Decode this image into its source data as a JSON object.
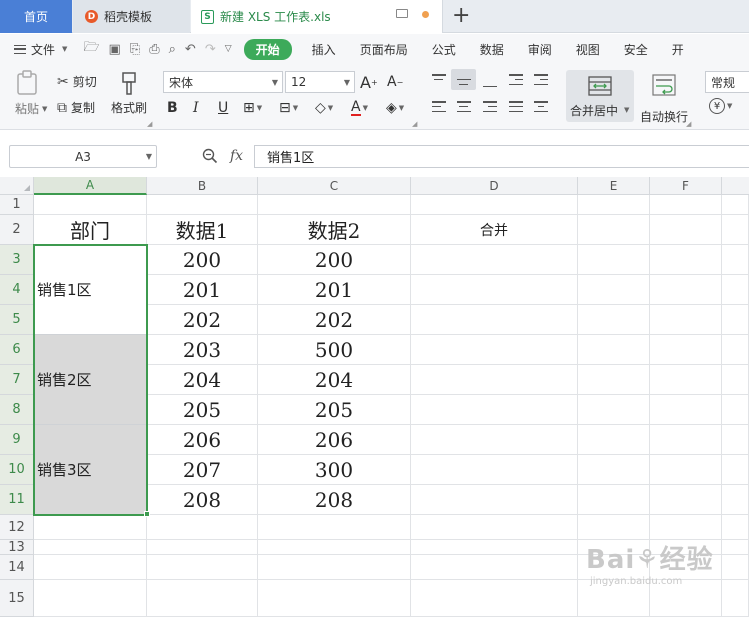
{
  "tabs": {
    "home": "首页",
    "templates": "稻壳模板",
    "document": "新建 XLS 工作表.xls",
    "new_tab": "+"
  },
  "menu": {
    "file": "文件",
    "items": [
      "开始",
      "插入",
      "页面布局",
      "公式",
      "数据",
      "审阅",
      "视图",
      "安全",
      "开"
    ],
    "active_index": 0
  },
  "ribbon": {
    "paste": "粘贴",
    "cut": "剪切",
    "copy": "复制",
    "format_painter": "格式刷",
    "font_name": "宋体",
    "font_size": "12",
    "merge_center": "合并居中",
    "wrap_text": "自动换行",
    "number_format": "常规",
    "currency_symbol": "¥"
  },
  "formula_bar": {
    "cell_ref": "A3",
    "fx": "fx",
    "content": "销售1区"
  },
  "sheet": {
    "columns": [
      "A",
      "B",
      "C",
      "D",
      "E",
      "F"
    ],
    "rows": [
      "1",
      "2",
      "3",
      "4",
      "5",
      "6",
      "7",
      "8",
      "9",
      "10",
      "11",
      "12",
      "13",
      "14",
      "15"
    ],
    "headers": {
      "a": "部门",
      "b": "数据1",
      "c": "数据2",
      "d": "合并"
    },
    "data1": [
      "200",
      "201",
      "202",
      "203",
      "204",
      "205",
      "206",
      "207",
      "208"
    ],
    "data2": [
      "200",
      "201",
      "202",
      "500",
      "204",
      "205",
      "206",
      "300",
      "208"
    ],
    "merged": [
      "销售1区",
      "销售2区",
      "销售3区"
    ]
  },
  "watermark": {
    "logo": "Bai⚘经验",
    "url": "jingyan.baidu.com"
  },
  "colors": {
    "accent_green": "#3daa5a",
    "home_tab_blue": "#4a7fd6",
    "merged_gray": "#d9d9d9"
  }
}
